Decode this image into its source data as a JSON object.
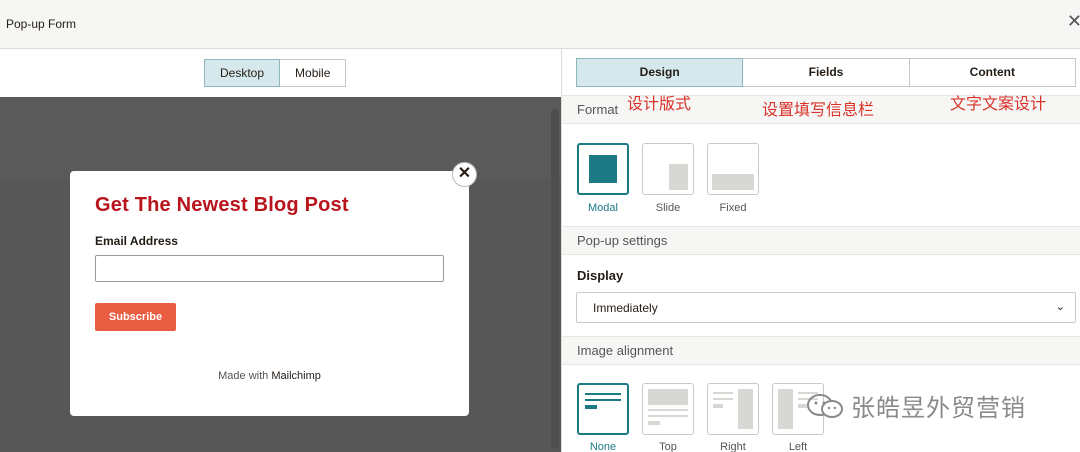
{
  "window": {
    "title": "Pop-up Form",
    "close_icon": "close-icon"
  },
  "preview": {
    "view_tabs": [
      "Desktop",
      "Mobile"
    ],
    "active_view": "Desktop",
    "form": {
      "heading": "Get The Newest Blog Post",
      "heading_color": "#b8141c",
      "email_label": "Email Address",
      "email_value": "",
      "subscribe_label": "Subscribe",
      "button_color": "#e85c41",
      "made_with_prefix": "Made with",
      "made_with_brand": "Mailchimp",
      "close_glyph": "✕"
    }
  },
  "settings": {
    "tabs": [
      "Design",
      "Fields",
      "Content"
    ],
    "active_tab": "Design",
    "annotations": [
      "设计版式",
      "设置填写信息栏",
      "文字文案设计"
    ],
    "format": {
      "header": "Format",
      "options": [
        "Modal",
        "Slide",
        "Fixed"
      ],
      "selected": "Modal"
    },
    "popup_settings": {
      "header": "Pop-up settings",
      "display_label": "Display",
      "display_value": "Immediately",
      "caret": "⌄"
    },
    "image_alignment": {
      "header": "Image alignment",
      "options": [
        "None",
        "Top",
        "Right",
        "Left"
      ],
      "selected": "None"
    },
    "accent_color": "#1c7a84"
  },
  "watermark": {
    "text": "张皓昱外贸营销",
    "icon": "wechat-icon"
  }
}
